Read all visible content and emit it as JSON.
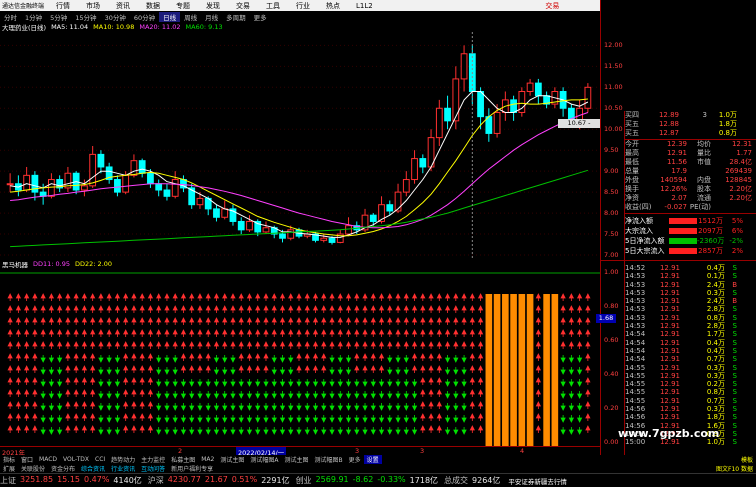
{
  "menubar": {
    "app_title": "通达信金融终端",
    "items": [
      "行情",
      "市场",
      "资讯",
      "数据",
      "专题",
      "发现",
      "交易",
      "工具",
      "行业",
      "热点",
      "L1L2"
    ],
    "right_label": "交易",
    "window_buttons": [
      "_",
      "□",
      "×"
    ]
  },
  "periods": {
    "items": [
      "分时",
      "1分钟",
      "5分钟",
      "15分钟",
      "30分钟",
      "60分钟",
      "日线",
      "周线",
      "月线",
      "多周期",
      "更多"
    ],
    "active": "日线"
  },
  "chart_title": {
    "stock": "大理药业(日线)",
    "ma5": "MA5: 11.04",
    "ma10": "MA10: 10.98",
    "ma20": "MA20: 11.02",
    "ma60": "MA60: 9.13"
  },
  "indicator_title": {
    "name": "黑马机器",
    "dd11": "DD11: 0.95",
    "dd22": "DD22: 2.00"
  },
  "price_axis": [
    "12.00",
    "11.50",
    "11.00",
    "10.50",
    "10.00",
    "9.50",
    "9.00",
    "8.50",
    "8.00",
    "7.50",
    "7.00"
  ],
  "indicator_axis": [
    "1.00",
    "0.80",
    "0.60",
    "0.40",
    "0.20",
    "0.00"
  ],
  "cursor_label": "10.67 - 11.11",
  "price_box": "1.68",
  "date_axis": {
    "labels": [
      "2021年",
      "2",
      "3",
      "2022/02/14/一",
      "3",
      "4"
    ]
  },
  "order_book": [
    {
      "label": "买四",
      "price": "12.89",
      "vol": "3",
      "diff": "1.0万"
    },
    {
      "label": "买五",
      "price": "12.88",
      "vol": "",
      "diff": "1.8万"
    },
    {
      "label": "买五",
      "price": "12.87",
      "vol": "",
      "diff": "0.8万"
    }
  ],
  "stats": [
    {
      "l1": "今开",
      "v1": "12.39",
      "l2": "均价",
      "v2": "12.31"
    },
    {
      "l1": "最高",
      "v1": "12.91",
      "l2": "量比",
      "v2": "1.77"
    },
    {
      "l1": "最低",
      "v1": "11.56",
      "l2": "市值",
      "v2": "28.4亿"
    },
    {
      "l1": "总量",
      "v1": "17.9",
      "l2": "",
      "v2": "269439"
    },
    {
      "l1": "外盘",
      "v1": "140594",
      "l2": "内盘",
      "v2": "128845"
    },
    {
      "l1": "换手",
      "v1": "12.26%",
      "l2": "股本",
      "v2": "2.20亿"
    },
    {
      "l1": "净资",
      "v1": "2.07",
      "l2": "流通",
      "v2": "2.20亿"
    },
    {
      "l1": "收益(四)",
      "v1": "-0.027",
      "l2": "PE(动)",
      "v2": ""
    }
  ],
  "flows": [
    {
      "label": "净流入额",
      "value": "1512万",
      "pct": "5%",
      "color": "#ff2020"
    },
    {
      "label": "大宗流入",
      "value": "2097万",
      "pct": "6%",
      "color": "#ff2020"
    },
    {
      "label": "5日净流入额",
      "value": "-2360万",
      "pct": "-2%",
      "color": "#00c000"
    },
    {
      "label": "5日大宗流入",
      "value": "2857万",
      "pct": "2%",
      "color": "#ff2020"
    }
  ],
  "ticks": [
    {
      "t": "14:52",
      "p": "12.91",
      "v": "0.4万",
      "d": "S"
    },
    {
      "t": "14:53",
      "p": "12.91",
      "v": "0.1万",
      "d": "S"
    },
    {
      "t": "14:53",
      "p": "12.91",
      "v": "2.4万",
      "d": "B"
    },
    {
      "t": "14:53",
      "p": "12.91",
      "v": "0.3万",
      "d": "S"
    },
    {
      "t": "14:53",
      "p": "12.91",
      "v": "2.4万",
      "d": "B"
    },
    {
      "t": "14:53",
      "p": "12.91",
      "v": "2.8万",
      "d": "S"
    },
    {
      "t": "14:53",
      "p": "12.91",
      "v": "0.8万",
      "d": "S"
    },
    {
      "t": "14:53",
      "p": "12.91",
      "v": "2.8万",
      "d": "S"
    },
    {
      "t": "14:54",
      "p": "12.91",
      "v": "1.7万",
      "d": "S"
    },
    {
      "t": "14:54",
      "p": "12.91",
      "v": "0.4万",
      "d": "S"
    },
    {
      "t": "14:54",
      "p": "12.91",
      "v": "0.4万",
      "d": "S"
    },
    {
      "t": "14:54",
      "p": "12.91",
      "v": "0.7万",
      "d": "S"
    },
    {
      "t": "14:55",
      "p": "12.91",
      "v": "0.3万",
      "d": "S"
    },
    {
      "t": "14:55",
      "p": "12.91",
      "v": "0.3万",
      "d": "S"
    },
    {
      "t": "14:55",
      "p": "12.91",
      "v": "0.2万",
      "d": "S"
    },
    {
      "t": "14:55",
      "p": "12.91",
      "v": "0.8万",
      "d": "S"
    },
    {
      "t": "14:55",
      "p": "12.91",
      "v": "0.7万",
      "d": "S"
    },
    {
      "t": "14:56",
      "p": "12.91",
      "v": "0.3万",
      "d": "S"
    },
    {
      "t": "14:56",
      "p": "12.91",
      "v": "1.8万",
      "d": "S"
    },
    {
      "t": "14:56",
      "p": "12.91",
      "v": "1.6万",
      "d": "S"
    },
    {
      "t": "14:56",
      "p": "12.91",
      "v": "0.3万",
      "d": "S"
    },
    {
      "t": "15:00",
      "p": "12.91",
      "v": "1.0万",
      "d": "S"
    }
  ],
  "tabs": {
    "items": [
      "指标",
      "窗口",
      "MACD",
      "VOL-TDX",
      "CCI",
      "趋势动力",
      "主力监控",
      "私募主图",
      "MA2",
      "测试主图",
      "测试幅图A",
      "测试主图",
      "测试幅图B",
      "更多",
      "设置"
    ],
    "active": "设置",
    "right": "模板"
  },
  "infobar": {
    "items": [
      "扩展",
      "关联股份",
      "资金分布",
      "综合资讯",
      "行业资讯",
      "互动问答",
      "新用户福利专享"
    ],
    "blue_items": [
      "综合资讯",
      "行业资讯",
      "互动问答"
    ],
    "right": "图文F10 数据"
  },
  "indexes": [
    {
      "name": "上证",
      "value": "3251.85",
      "change": "15.15",
      "pct": "0.47%",
      "volume": "4140亿",
      "dir": "up"
    },
    {
      "name": "沪深",
      "value": "4230.77",
      "change": "21.67",
      "pct": "0.51%",
      "volume": "2291亿",
      "dir": "up"
    },
    {
      "name": "创业",
      "value": "2569.91",
      "change": "-8.62",
      "pct": "-0.33%",
      "volume": "1718亿",
      "dir": "down"
    },
    {
      "name": "总成交",
      "value": "",
      "change": "",
      "pct": "",
      "volume": "9264亿",
      "dir": "none"
    }
  ],
  "news": "平安证券新疆去行情",
  "watermark": "www.7gpzb.com",
  "colors": {
    "up": "#ff3030",
    "down": "#00ffff",
    "ma5": "#ffffff",
    "ma10": "#ffff00",
    "ma20": "#ff40ff",
    "ma60": "#00c000"
  },
  "chart_data": {
    "type": "candlestick",
    "title": "大理药业(日线)",
    "ylim": [
      7.0,
      12.2
    ],
    "candles": [
      [
        8.7,
        8.7,
        8.95,
        8.5
      ],
      [
        8.7,
        8.55,
        8.9,
        8.4
      ],
      [
        8.55,
        8.9,
        9.1,
        8.5
      ],
      [
        8.9,
        8.5,
        9.0,
        8.3
      ],
      [
        8.5,
        8.4,
        8.7,
        8.2
      ],
      [
        8.4,
        8.8,
        8.95,
        8.35
      ],
      [
        8.8,
        8.6,
        8.9,
        8.5
      ],
      [
        8.6,
        8.95,
        9.1,
        8.5
      ],
      [
        8.95,
        8.55,
        9.0,
        8.45
      ],
      [
        8.55,
        8.65,
        8.8,
        8.4
      ],
      [
        8.65,
        9.4,
        9.6,
        8.6
      ],
      [
        9.4,
        9.1,
        9.5,
        8.95
      ],
      [
        9.1,
        8.8,
        9.2,
        8.7
      ],
      [
        8.8,
        8.5,
        8.9,
        8.4
      ],
      [
        8.5,
        8.9,
        9.0,
        8.45
      ],
      [
        8.9,
        9.25,
        9.4,
        8.85
      ],
      [
        9.25,
        8.95,
        9.3,
        8.85
      ],
      [
        8.95,
        8.7,
        9.05,
        8.6
      ],
      [
        8.7,
        8.55,
        8.8,
        8.4
      ],
      [
        8.55,
        8.4,
        8.7,
        8.3
      ],
      [
        8.4,
        8.8,
        9.0,
        8.35
      ],
      [
        8.8,
        8.6,
        8.9,
        8.5
      ],
      [
        8.6,
        8.2,
        8.7,
        8.1
      ],
      [
        8.2,
        8.35,
        8.5,
        8.1
      ],
      [
        8.35,
        8.1,
        8.4,
        7.95
      ],
      [
        8.1,
        7.9,
        8.2,
        7.8
      ],
      [
        7.9,
        8.1,
        8.3,
        7.85
      ],
      [
        8.1,
        7.8,
        8.2,
        7.7
      ],
      [
        7.8,
        7.6,
        7.9,
        7.5
      ],
      [
        7.6,
        7.8,
        7.95,
        7.55
      ],
      [
        7.8,
        7.55,
        7.85,
        7.45
      ],
      [
        7.55,
        7.65,
        7.8,
        7.5
      ],
      [
        7.65,
        7.5,
        7.7,
        7.4
      ],
      [
        7.5,
        7.4,
        7.6,
        7.3
      ],
      [
        7.4,
        7.6,
        7.7,
        7.35
      ],
      [
        7.6,
        7.45,
        7.65,
        7.4
      ],
      [
        7.45,
        7.5,
        7.6,
        7.4
      ],
      [
        7.5,
        7.35,
        7.55,
        7.3
      ],
      [
        7.35,
        7.4,
        7.5,
        7.3
      ],
      [
        7.4,
        7.3,
        7.45,
        7.25
      ],
      [
        7.3,
        7.5,
        7.6,
        7.28
      ],
      [
        7.5,
        7.7,
        7.9,
        7.45
      ],
      [
        7.7,
        7.6,
        7.8,
        7.5
      ],
      [
        7.6,
        7.95,
        8.1,
        7.55
      ],
      [
        7.95,
        7.8,
        8.0,
        7.7
      ],
      [
        7.8,
        8.2,
        8.4,
        7.75
      ],
      [
        8.2,
        8.05,
        8.3,
        7.95
      ],
      [
        8.05,
        8.5,
        8.7,
        8.0
      ],
      [
        8.5,
        8.8,
        9.0,
        8.4
      ],
      [
        8.8,
        9.3,
        9.5,
        8.7
      ],
      [
        9.3,
        9.1,
        9.4,
        8.95
      ],
      [
        9.1,
        9.8,
        10.0,
        9.0
      ],
      [
        9.8,
        10.5,
        10.7,
        9.6
      ],
      [
        10.5,
        10.2,
        10.8,
        10.0
      ],
      [
        10.2,
        11.2,
        11.5,
        10.0
      ],
      [
        11.2,
        11.8,
        12.0,
        10.9
      ],
      [
        11.8,
        10.9,
        12.0,
        10.6
      ],
      [
        10.9,
        10.3,
        11.0,
        10.0
      ],
      [
        10.3,
        9.9,
        10.5,
        9.7
      ],
      [
        9.9,
        10.4,
        10.6,
        9.8
      ],
      [
        10.4,
        10.7,
        10.9,
        10.2
      ],
      [
        10.7,
        10.4,
        10.8,
        10.2
      ],
      [
        10.4,
        10.9,
        11.0,
        10.3
      ],
      [
        10.9,
        11.1,
        11.2,
        10.8
      ],
      [
        11.1,
        10.8,
        11.2,
        10.6
      ],
      [
        10.8,
        10.6,
        10.9,
        10.5
      ],
      [
        10.6,
        10.9,
        11.0,
        10.5
      ],
      [
        10.9,
        10.5,
        11.0,
        10.3
      ],
      [
        10.5,
        10.2,
        10.6,
        10.1
      ],
      [
        10.2,
        10.5,
        10.7,
        10.0
      ],
      [
        10.5,
        11.0,
        11.1,
        10.4
      ]
    ],
    "ma5": [
      8.65,
      8.62,
      8.7,
      8.65,
      8.6,
      8.7,
      8.65,
      8.7,
      8.75,
      8.7,
      8.85,
      9.0,
      9.0,
      8.95,
      8.9,
      9.0,
      9.05,
      9.0,
      8.9,
      8.75,
      8.7,
      8.65,
      8.55,
      8.45,
      8.35,
      8.2,
      8.1,
      8.05,
      7.95,
      7.85,
      7.75,
      7.7,
      7.65,
      7.55,
      7.55,
      7.52,
      7.5,
      7.48,
      7.45,
      7.42,
      7.42,
      7.48,
      7.55,
      7.65,
      7.72,
      7.85,
      7.95,
      8.1,
      8.3,
      8.55,
      8.8,
      9.1,
      9.5,
      9.9,
      10.3,
      10.7,
      10.9,
      10.9,
      10.7,
      10.5,
      10.4,
      10.4,
      10.5,
      10.7,
      10.8,
      10.8,
      10.75,
      10.7,
      10.6,
      10.55,
      10.65
    ],
    "ma10": [
      8.5,
      8.52,
      8.55,
      8.58,
      8.6,
      8.62,
      8.63,
      8.65,
      8.66,
      8.68,
      8.72,
      8.78,
      8.85,
      8.88,
      8.9,
      8.92,
      8.95,
      8.97,
      8.95,
      8.9,
      8.85,
      8.8,
      8.72,
      8.62,
      8.52,
      8.42,
      8.32,
      8.22,
      8.12,
      8.02,
      7.92,
      7.85,
      7.78,
      7.72,
      7.66,
      7.6,
      7.56,
      7.53,
      7.5,
      7.48,
      7.46,
      7.46,
      7.48,
      7.52,
      7.56,
      7.62,
      7.7,
      7.8,
      7.92,
      8.08,
      8.25,
      8.45,
      8.7,
      8.98,
      9.25,
      9.55,
      9.85,
      10.1,
      10.3,
      10.45,
      10.55,
      10.6,
      10.62,
      10.6,
      10.6,
      10.62,
      10.65,
      10.68,
      10.7,
      10.7,
      10.72
    ],
    "ma20": [
      8.3,
      8.32,
      8.35,
      8.38,
      8.4,
      8.42,
      8.45,
      8.47,
      8.5,
      8.52,
      8.55,
      8.58,
      8.6,
      8.62,
      8.64,
      8.66,
      8.68,
      8.7,
      8.7,
      8.7,
      8.69,
      8.68,
      8.66,
      8.63,
      8.6,
      8.56,
      8.52,
      8.47,
      8.42,
      8.36,
      8.3,
      8.24,
      8.18,
      8.12,
      8.06,
      8.0,
      7.95,
      7.9,
      7.85,
      7.8,
      7.76,
      7.72,
      7.68,
      7.66,
      7.65,
      7.65,
      7.66,
      7.68,
      7.72,
      7.78,
      7.85,
      7.95,
      8.07,
      8.2,
      8.35,
      8.52,
      8.7,
      8.88,
      9.05,
      9.2,
      9.35,
      9.5,
      9.63,
      9.75,
      9.87,
      9.97,
      10.07,
      10.16,
      10.25,
      10.33,
      10.4
    ],
    "ma60": [
      7.2,
      7.21,
      7.22,
      7.23,
      7.24,
      7.25,
      7.26,
      7.27,
      7.28,
      7.29,
      7.3,
      7.31,
      7.32,
      7.33,
      7.34,
      7.35,
      7.36,
      7.37,
      7.38,
      7.39,
      7.4,
      7.41,
      7.42,
      7.43,
      7.44,
      7.45,
      7.46,
      7.47,
      7.48,
      7.49,
      7.5,
      7.51,
      7.52,
      7.53,
      7.54,
      7.55,
      7.56,
      7.57,
      7.58,
      7.59,
      7.6,
      7.62,
      7.64,
      7.66,
      7.68,
      7.7,
      7.72,
      7.75,
      7.78,
      7.82,
      7.86,
      7.9,
      7.95,
      8.0,
      8.06,
      8.12,
      8.18,
      8.24,
      8.3,
      8.36,
      8.42,
      8.48,
      8.54,
      8.6,
      8.66,
      8.72,
      8.78,
      8.84,
      8.9,
      8.96,
      9.02
    ]
  }
}
